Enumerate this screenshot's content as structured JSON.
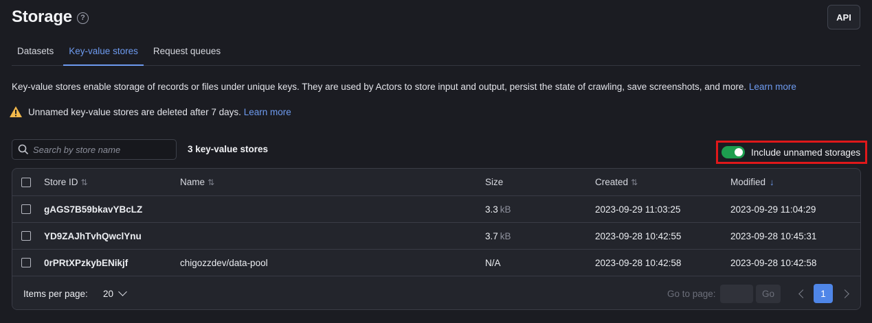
{
  "header": {
    "title": "Storage",
    "help_icon": "question-circle-icon",
    "api_label": "API"
  },
  "tabs": [
    {
      "label": "Datasets",
      "active": false
    },
    {
      "label": "Key-value stores",
      "active": true
    },
    {
      "label": "Request queues",
      "active": false
    }
  ],
  "description": {
    "text": "Key-value stores enable storage of records or files under unique keys. They are used by Actors to store input and output, persist the state of crawling, save screenshots, and more. ",
    "link": "Learn more"
  },
  "warning": {
    "icon": "warning-triangle-icon",
    "text": "Unnamed key-value stores are deleted after 7 days. ",
    "link": "Learn more"
  },
  "search": {
    "placeholder": "Search by store name",
    "value": ""
  },
  "store_count": "3 key-value stores",
  "toggle": {
    "label": "Include unnamed storages",
    "on": true,
    "color": "#1d9e4f",
    "highlight_color": "#e0181a"
  },
  "table": {
    "columns": [
      "Store ID",
      "Name",
      "Size",
      "Created",
      "Modified"
    ],
    "rows": [
      {
        "id": "gAGS7B59bkavYBcLZ",
        "name": "",
        "size": "3.3",
        "unit": "kB",
        "created": "2023-09-29 11:03:25",
        "modified": "2023-09-29 11:04:29"
      },
      {
        "id": "YD9ZAJhTvhQwclYnu",
        "name": "",
        "size": "3.7",
        "unit": "kB",
        "created": "2023-09-28 10:42:55",
        "modified": "2023-09-28 10:45:31"
      },
      {
        "id": "0rPRtXPzkybENikjf",
        "name": "chigozzdev/data-pool",
        "size": "N/A",
        "unit": "",
        "created": "2023-09-28 10:42:58",
        "modified": "2023-09-28 10:42:58"
      }
    ]
  },
  "pagination": {
    "items_per_page_label": "Items per page:",
    "items_per_page": "20",
    "goto_label": "Go to page:",
    "go_label": "Go",
    "current_page": "1"
  },
  "colors": {
    "accent": "#6e9bf0",
    "background": "#1b1c22",
    "table_bg": "#23252c"
  }
}
